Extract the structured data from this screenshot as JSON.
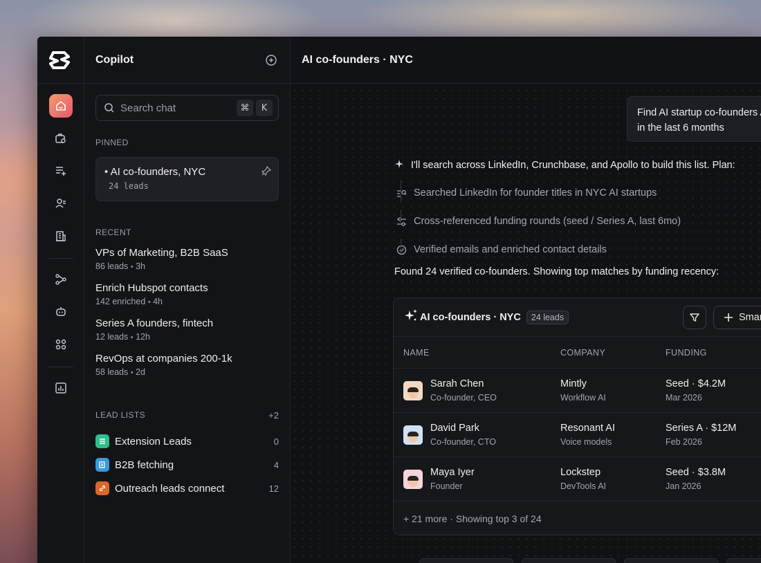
{
  "sidebar": {
    "title": "Copilot",
    "search_placeholder": "Search chat",
    "kbd_cmd": "⌘",
    "kbd_k": "K",
    "pinned_label": "PINNED",
    "pinned": {
      "title": "• AI co-founders, NYC",
      "sub": "24 leads"
    },
    "recent_label": "RECENT",
    "recent": [
      {
        "title": "VPs of Marketing, B2B SaaS",
        "meta": "86 leads",
        "age": "3h"
      },
      {
        "title": "Enrich Hubspot contacts",
        "meta": "142 enriched",
        "age": "4h"
      },
      {
        "title": "Series A founders, fintech",
        "meta": "12 leads",
        "age": "12h"
      },
      {
        "title": "RevOps at companies 200-1k",
        "meta": "58 leads",
        "age": "2d"
      }
    ],
    "lead_lists_label": "LEAD LISTS",
    "lead_lists_more": "+2",
    "lead_lists": [
      {
        "name": "Extension Leads",
        "count": "0",
        "color": "#2fbf8a"
      },
      {
        "name": "B2B fetching",
        "count": "4",
        "color": "#3a9bd9"
      },
      {
        "name": "Outreach leads connect",
        "count": "12",
        "color": "#d9682b"
      }
    ]
  },
  "main": {
    "title": "AI co-founders · NYC",
    "user_message": "Find AI startup co-founders A in the last 6 months",
    "ai_intro": "I'll search across LinkedIn, Crunchbase, and Apollo to build this list. Plan:",
    "steps": [
      "Searched LinkedIn for founder titles in NYC AI startups",
      "Cross-referenced funding rounds (seed / Series A, last 6mo)",
      "Verified emails and enriched contact details"
    ],
    "found_text": "Found 24 verified co-founders. Showing top matches by funding recency:",
    "results": {
      "title": "AI co-founders · NYC",
      "badge": "24 leads",
      "smart_label": "Smar",
      "columns": [
        "NAME",
        "COMPANY",
        "FUNDING"
      ],
      "rows": [
        {
          "name": "Sarah Chen",
          "role": "Co-founder, CEO",
          "company": "Mintly",
          "company_sub": "Workflow AI",
          "funding": "Seed · $4.2M",
          "date": "Mar 2026",
          "avatar_bg": "#f3d9c4"
        },
        {
          "name": "David Park",
          "role": "Co-founder, CTO",
          "company": "Resonant AI",
          "company_sub": "Voice models",
          "funding": "Series A · $12M",
          "date": "Feb 2026",
          "avatar_bg": "#cfe2f5"
        },
        {
          "name": "Maya Iyer",
          "role": "Founder",
          "company": "Lockstep",
          "company_sub": "DevTools AI",
          "funding": "Seed · $3.8M",
          "date": "Jan 2026",
          "avatar_bg": "#f6d4d9"
        }
      ],
      "footer": "+ 21 more · Showing top 3 of 24"
    }
  }
}
